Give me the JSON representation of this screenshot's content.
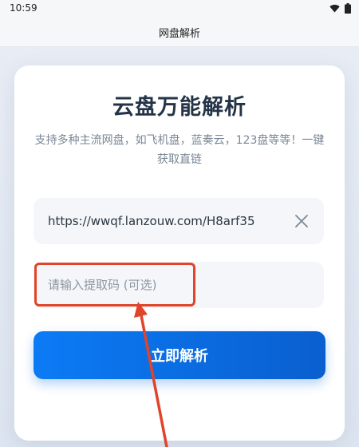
{
  "status_bar": {
    "time": "10:59"
  },
  "app_bar": {
    "title": "网盘解析"
  },
  "card": {
    "title": "云盘万能解析",
    "subtitle": "支持多种主流网盘，如飞机盘，蓝奏云，123盘等等！一键获取直链"
  },
  "url_field": {
    "value": "https://wwqf.lanzouw.com/H8arf35"
  },
  "code_field": {
    "placeholder": "请输入提取码 (可选)",
    "value": ""
  },
  "submit_button": {
    "label": "立即解析"
  },
  "colors": {
    "accent": "#0b6ee6",
    "annotation": "#e0442b",
    "title": "#243447",
    "subtitle": "#7a8796"
  },
  "icons": [
    "wifi-icon",
    "battery-icon",
    "close-icon"
  ]
}
